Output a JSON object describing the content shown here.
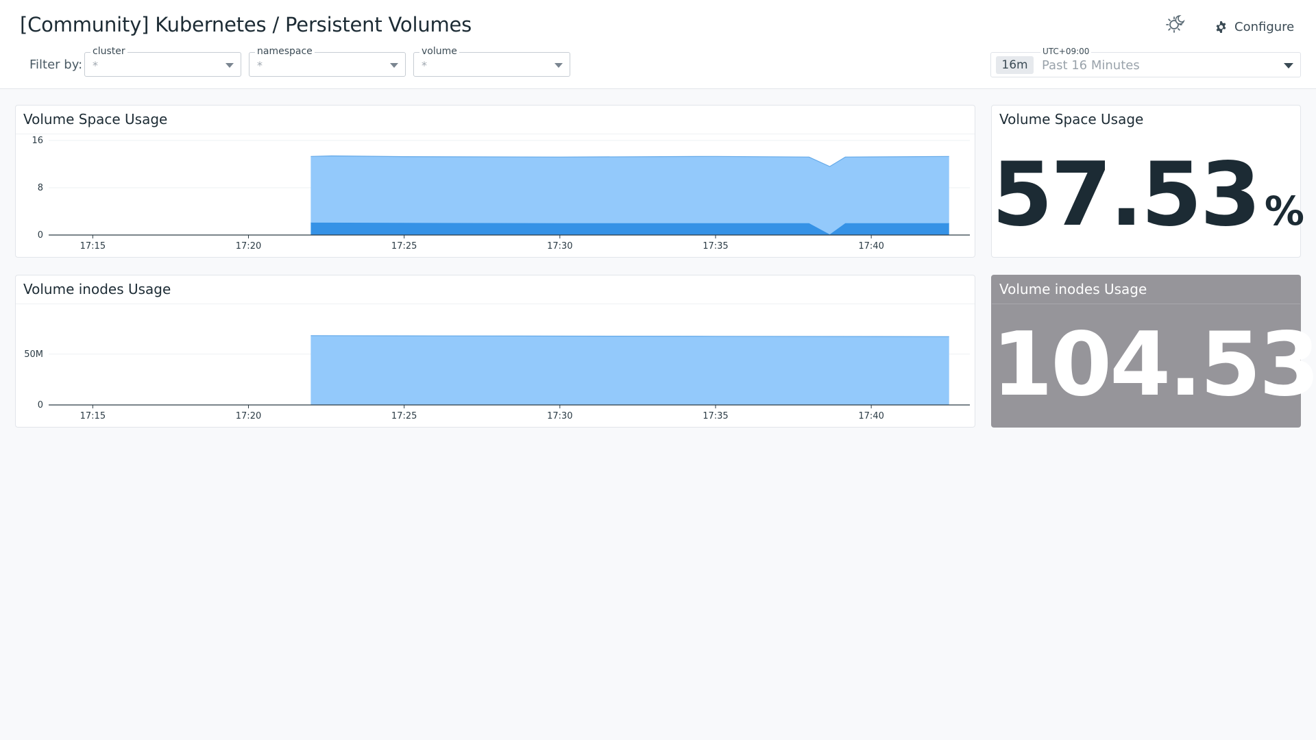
{
  "header": {
    "title": "[Community] Kubernetes / Persistent Volumes",
    "configure_label": "Configure",
    "filter_label": "Filter by:",
    "filters": [
      {
        "name": "cluster",
        "value": "*"
      },
      {
        "name": "namespace",
        "value": "*"
      },
      {
        "name": "volume",
        "value": "*"
      }
    ],
    "time": {
      "timezone": "UTC+09:00",
      "badge": "16m",
      "label": "Past 16 Minutes"
    }
  },
  "colors": {
    "series_light": "#93c9fb",
    "series_light_stroke": "#64a9e8",
    "series_dark": "#3592e6",
    "axis": "#2a3a44",
    "dark_widget_bg": "#96959a"
  },
  "widgets": {
    "space_timeseries": {
      "title": "Volume Space Usage"
    },
    "space_value": {
      "title": "Volume Space Usage",
      "value": "57.53",
      "unit": "%"
    },
    "inodes_timeseries": {
      "title": "Volume inodes Usage"
    },
    "inodes_value": {
      "title": "Volume inodes Usage",
      "value": "104.53",
      "unit": "%"
    }
  },
  "chart_data": [
    {
      "type": "area",
      "title": "Volume Space Usage",
      "x_ticks": [
        "17:15",
        "17:20",
        "17:25",
        "17:30",
        "17:35",
        "17:40"
      ],
      "x_range": [
        "17:13:35",
        "17:43:10"
      ],
      "y_ticks": [
        0,
        8,
        16
      ],
      "ylim": [
        0,
        16
      ],
      "grid": true,
      "stacked": true,
      "series": [
        {
          "color": "#3592e6",
          "points": [
            [
              "17:22:00",
              2.1
            ],
            [
              "17:30:00",
              2.0
            ],
            [
              "17:38:00",
              2.0
            ],
            [
              "17:38:40",
              0.1
            ],
            [
              "17:39:10",
              2.0
            ],
            [
              "17:42:30",
              2.0
            ]
          ]
        },
        {
          "color": "#93c9fb",
          "points": [
            [
              "17:22:00",
              11.2
            ],
            [
              "17:22:40",
              11.3
            ],
            [
              "17:25:00",
              11.2
            ],
            [
              "17:30:00",
              11.2
            ],
            [
              "17:35:00",
              11.3
            ],
            [
              "17:38:00",
              11.2
            ],
            [
              "17:38:40",
              11.5
            ],
            [
              "17:39:10",
              11.2
            ],
            [
              "17:42:30",
              11.3
            ]
          ]
        }
      ]
    },
    {
      "type": "area",
      "title": "Volume inodes Usage",
      "x_ticks": [
        "17:15",
        "17:20",
        "17:25",
        "17:30",
        "17:35",
        "17:40"
      ],
      "x_range": [
        "17:13:35",
        "17:43:10"
      ],
      "y_ticks": [
        0,
        50000000
      ],
      "y_tick_labels": [
        "0",
        "50M"
      ],
      "ylim": [
        0,
        93000000
      ],
      "grid": true,
      "series": [
        {
          "color": "#93c9fb",
          "points": [
            [
              "17:22:00",
              68200000
            ],
            [
              "17:25:00",
              68000000
            ],
            [
              "17:30:00",
              67700000
            ],
            [
              "17:35:00",
              67500000
            ],
            [
              "17:40:00",
              67300000
            ],
            [
              "17:42:30",
              67200000
            ]
          ]
        }
      ]
    }
  ]
}
